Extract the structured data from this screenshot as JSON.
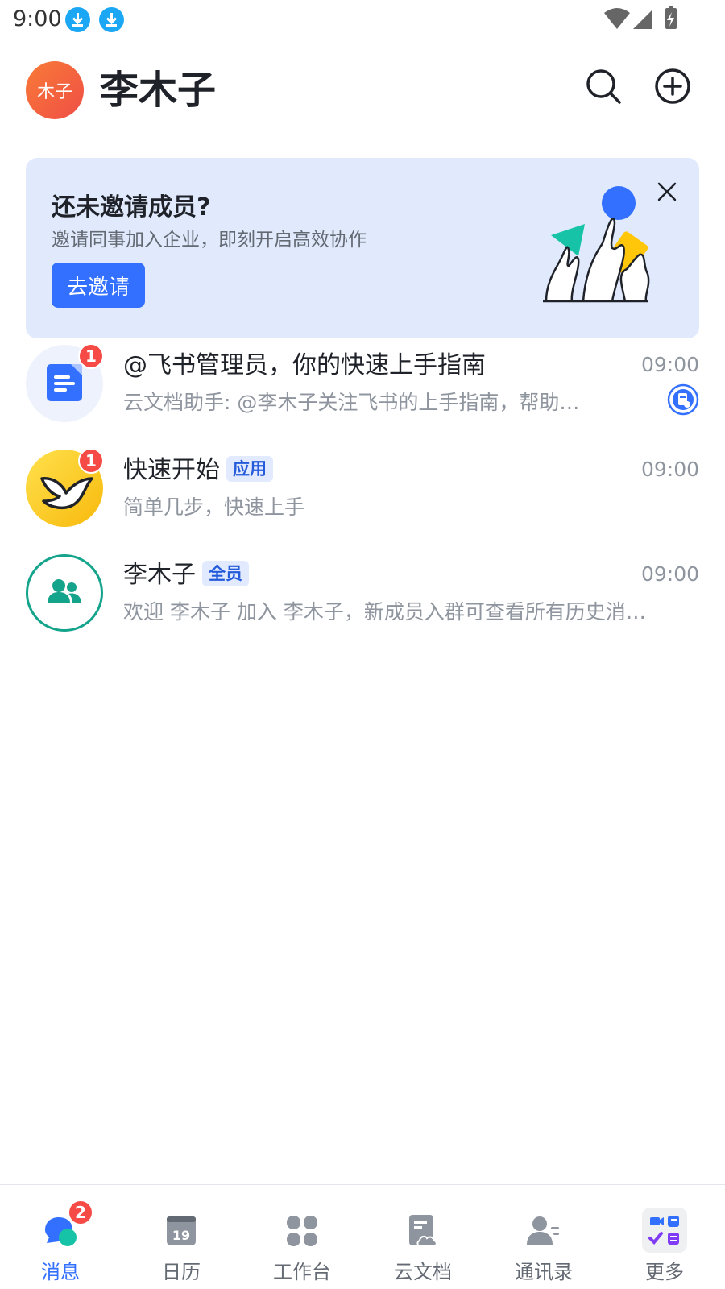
{
  "status_bar": {
    "time": "9:00"
  },
  "header": {
    "avatar_text": "木子",
    "title": "李木子"
  },
  "banner": {
    "title": "还未邀请成员?",
    "subtitle": "邀请同事加入企业，即刻开启高效协作",
    "button_label": "去邀请"
  },
  "chats": [
    {
      "name": "@飞书管理员，你的快速上手指南",
      "preview": "云文档助手: @李木子关注飞书的上手指南，帮助…",
      "time": "09:00",
      "unread": "1",
      "tag": ""
    },
    {
      "name": "快速开始",
      "preview": "简单几步，快速上手",
      "time": "09:00",
      "unread": "1",
      "tag": "应用"
    },
    {
      "name": "李木子",
      "preview": "欢迎 李木子 加入 李木子，新成员入群可查看所有历史消…",
      "time": "09:00",
      "unread": "",
      "tag": "全员"
    }
  ],
  "tabs": [
    {
      "label": "消息",
      "icon": "message-icon",
      "active": true,
      "badge": "2"
    },
    {
      "label": "日历",
      "icon": "calendar-icon",
      "active": false,
      "day": "19"
    },
    {
      "label": "工作台",
      "icon": "workplace-icon",
      "active": false
    },
    {
      "label": "云文档",
      "icon": "cloud-doc-icon",
      "active": false
    },
    {
      "label": "通讯录",
      "icon": "contacts-icon",
      "active": false
    },
    {
      "label": "更多",
      "icon": "more-apps-icon",
      "active": false
    }
  ],
  "colors": {
    "accent": "#3370ff",
    "badge": "#f54a45",
    "banner_bg": "#e1eafd"
  }
}
